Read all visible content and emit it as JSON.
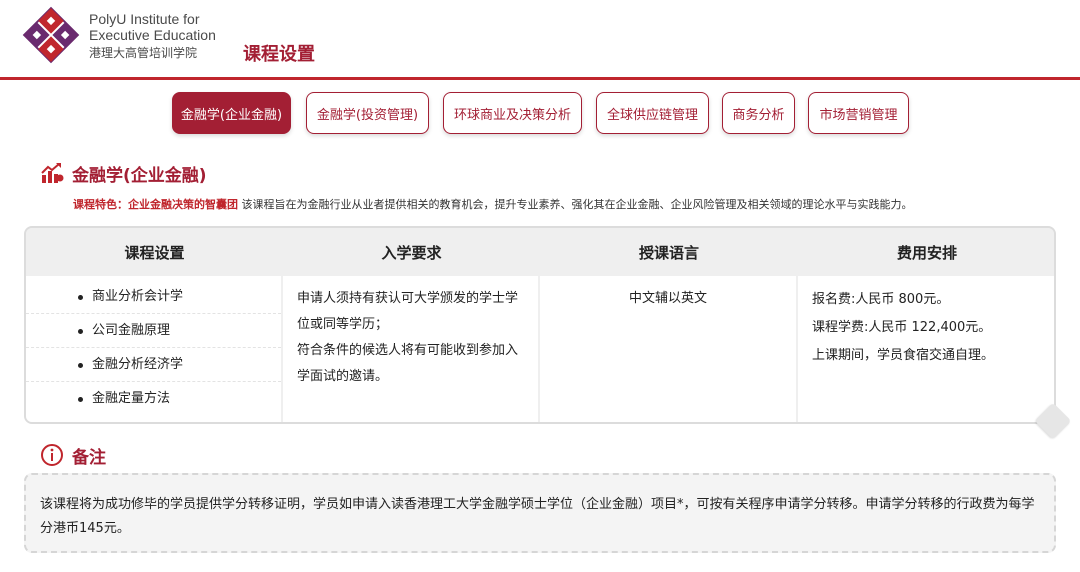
{
  "header": {
    "institute_line1": "PolyU Institute for",
    "institute_line2": "Executive Education",
    "institute_cn": "港理大高管培训学院",
    "page_title": "课程设置"
  },
  "tabs": [
    {
      "label": "金融学(企业金融)",
      "active": true
    },
    {
      "label": "金融学(投资管理)",
      "active": false
    },
    {
      "label": "环球商业及决策分析",
      "active": false
    },
    {
      "label": "全球供应链管理",
      "active": false
    },
    {
      "label": "商务分析",
      "active": false
    },
    {
      "label": "市场营销管理",
      "active": false
    }
  ],
  "section": {
    "title": "金融学(企业金融)",
    "feature_label": "课程特色：",
    "feature_highlight": "企业金融决策的智囊团",
    "feature_text": "该课程旨在为金融行业从业者提供相关的教育机会，提升专业素养、强化其在企业金融、企业风险管理及相关领域的理论水平与实践能力。"
  },
  "table": {
    "headers": [
      "课程设置",
      "入学要求",
      "授课语言",
      "费用安排"
    ],
    "courses": [
      "商业分析会计学",
      "公司金融原理",
      "金融分析经济学",
      "金融定量方法"
    ],
    "admission_1": "申请人须持有获认可大学颁发的学士学位或同等学历；",
    "admission_2": "符合条件的候选人将有可能收到参加入学面试的邀请。",
    "language": "中文辅以英文",
    "fee_1": "报名费:人民币 800元。",
    "fee_2": "课程学费:人民币 122,400元。",
    "fee_3": "上课期间，学员食宿交通自理。"
  },
  "notes": {
    "title": "备注",
    "text": "该课程将为成功修毕的学员提供学分转移证明，学员如申请入读香港理工大学金融学硕士学位（企业金融）项目*，可按有关程序申请学分转移。申请学分转移的行政费为每学分港币145元。"
  },
  "colors": {
    "brand": "#a31f34",
    "accent_red": "#c0262d",
    "logo_purple": "#6a2a6e"
  },
  "icons": [
    "polyu-logo",
    "chart-growth-icon",
    "info-circle-icon"
  ]
}
